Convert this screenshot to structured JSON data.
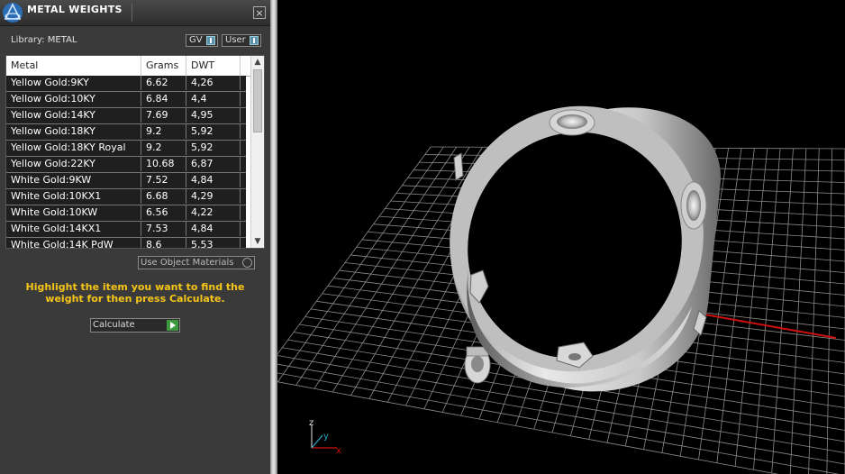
{
  "window": {
    "title": "METAL WEIGHTS",
    "close_symbol": "×"
  },
  "library": {
    "label": "Library: METAL",
    "toggle_gv": "GV",
    "toggle_user": "User"
  },
  "table": {
    "columns": [
      "Metal",
      "Grams",
      "DWT"
    ],
    "rows": [
      {
        "metal": "Yellow Gold:9KY",
        "grams": "6.62",
        "dwt": "4,26"
      },
      {
        "metal": "Yellow Gold:10KY",
        "grams": "6.84",
        "dwt": "4,4"
      },
      {
        "metal": "Yellow Gold:14KY",
        "grams": "7.69",
        "dwt": "4,95"
      },
      {
        "metal": "Yellow Gold:18KY",
        "grams": "9.2",
        "dwt": "5,92"
      },
      {
        "metal": "Yellow Gold:18KY Royal",
        "grams": "9.2",
        "dwt": "5,92"
      },
      {
        "metal": "Yellow Gold:22KY",
        "grams": "10.68",
        "dwt": "6,87"
      },
      {
        "metal": "White Gold:9KW",
        "grams": "7.52",
        "dwt": "4,84"
      },
      {
        "metal": "White Gold:10KX1",
        "grams": "6.68",
        "dwt": "4,29"
      },
      {
        "metal": "White Gold:10KW",
        "grams": "6.56",
        "dwt": "4,22"
      },
      {
        "metal": "White Gold:14KX1",
        "grams": "7.53",
        "dwt": "4,84"
      },
      {
        "metal": "White Gold:14K PdW",
        "grams": "8.6",
        "dwt": "5,53"
      }
    ]
  },
  "options": {
    "use_object_materials": "Use Object Materials"
  },
  "instructions": "Highlight the item you want to find the weight for then press Calculate.",
  "calculate_label": "Calculate",
  "axis": {
    "x": "x",
    "y": "y",
    "z": "z"
  },
  "colors": {
    "panel_bg": "#3a3a3a",
    "instructions": "#f5c518",
    "grid": "#8a8a8a",
    "axis_x": "#d01010",
    "axis_y": "#2aa8c8"
  }
}
